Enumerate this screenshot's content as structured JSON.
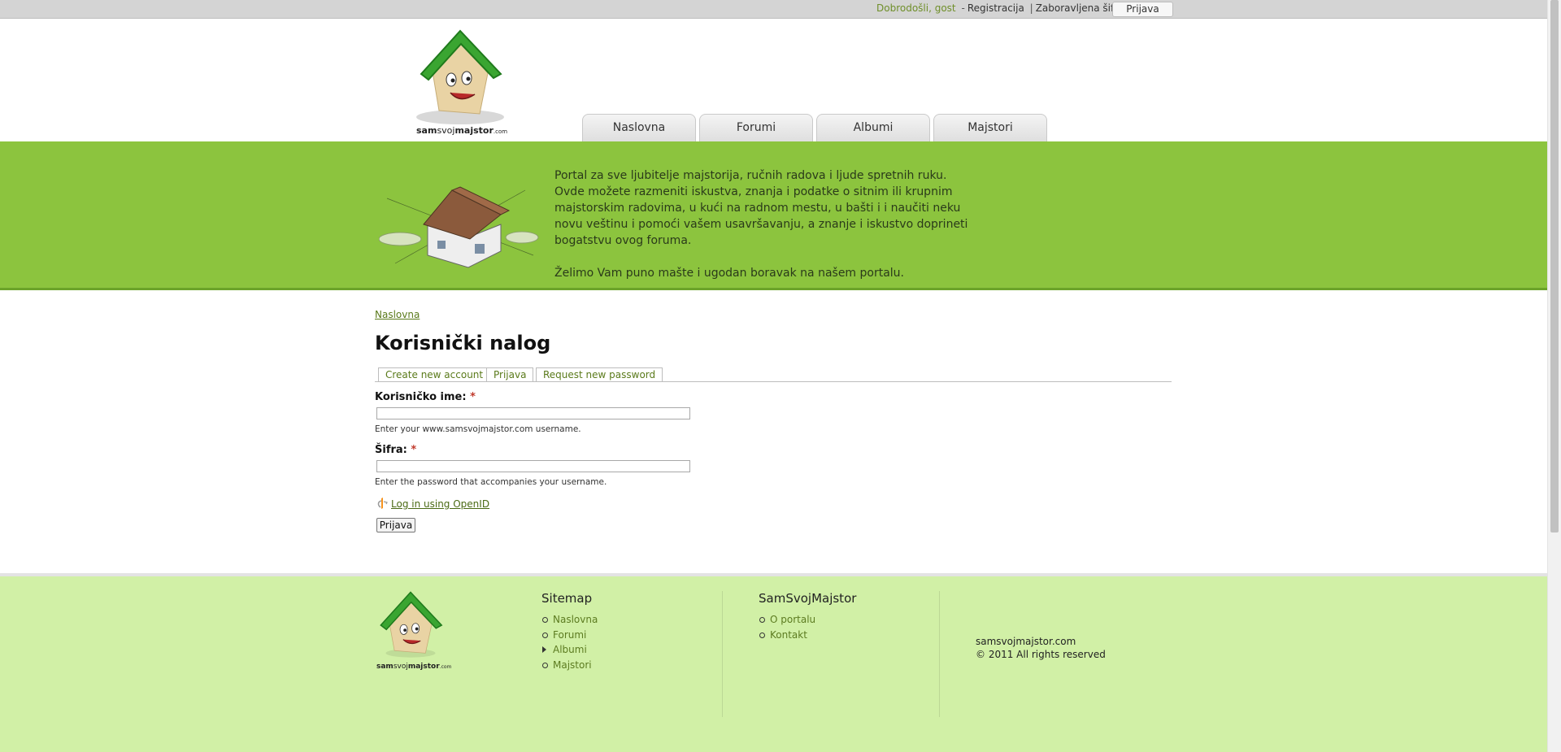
{
  "topbar": {
    "welcome": "Dobrodošli, gost",
    "dash": "-",
    "register": "Registracija",
    "sep": "|",
    "forgot": "Zaboravljena šifra",
    "login": "Prijava"
  },
  "logo": {
    "text_sam": "sam",
    "text_svoj": "svoj",
    "text_majstor": "majstor",
    "text_com": ".com"
  },
  "nav": [
    "Naslovna",
    "Forumi",
    "Albumi",
    "Majstori"
  ],
  "intro": {
    "paragraph1": "Portal za sve ljubitelje majstorija, ručnih radova i ljude spretnih ruku. Ovde možete razmeniti iskustva, znanja i podatke o sitnim ili krupnim majstorskim radovima, u kući na radnom mestu, u bašti i i naučiti neku novu veštinu i pomoći vašem usavršavanju, a znanje i iskustvo doprineti bogatstvu ovog foruma.",
    "paragraph2": "Želimo Vam puno mašte i ugodan boravak na našem portalu."
  },
  "breadcrumb": "Naslovna",
  "page_title": "Korisnički nalog",
  "tabs": [
    "Create new account",
    "Prijava",
    "Request new password"
  ],
  "form": {
    "username_label": "Korisničko ime:",
    "username_value": "",
    "username_desc": "Enter your www.samsvojmajstor.com username.",
    "password_label": "Šifra:",
    "password_value": "",
    "password_desc": "Enter the password that accompanies your username.",
    "required_mark": "*",
    "openid_link": "Log in using OpenID",
    "submit": "Prijava"
  },
  "footer": {
    "sitemap_title": "Sitemap",
    "sitemap_items": [
      "Naslovna",
      "Forumi",
      "Albumi",
      "Majstori"
    ],
    "site_title": "SamSvojMajstor",
    "site_items": [
      "O portalu",
      "Kontakt"
    ],
    "domain": "samsvojmajstor.com",
    "rights": "© 2011 All rights reserved"
  },
  "colors": {
    "band": "#8cc43e",
    "footer": "#d1f0a6",
    "link": "#5a7a1a"
  },
  "icons": [
    "house-mascot-logo",
    "house-construction-illustration",
    "openid-icon"
  ]
}
